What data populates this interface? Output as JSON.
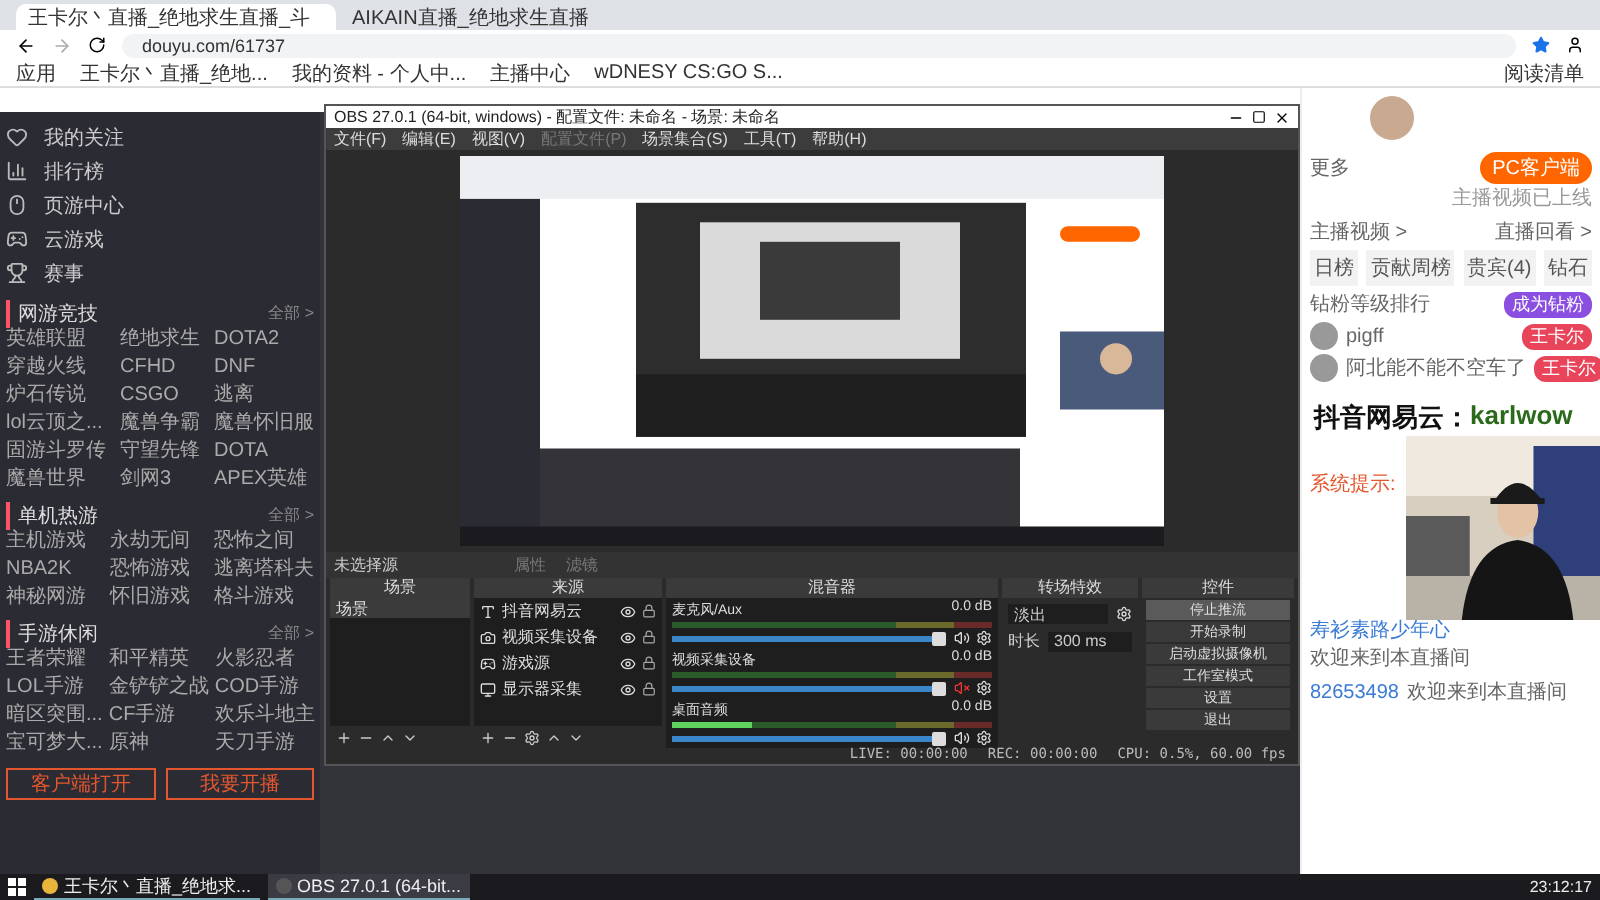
{
  "browser": {
    "tabs": [
      {
        "title": "王卡尔丶直播_绝地求生直播_斗",
        "selected": true
      },
      {
        "title": "AIKAIN直播_绝地求生直播",
        "selected": false
      }
    ],
    "url": "douyu.com/61737",
    "bookmarks": [
      "应用",
      "王卡尔丶直播_绝地...",
      "我的资料 - 个人中...",
      "主播中心",
      "wDNESY CS:GO S..."
    ],
    "reading_list": "阅读清单"
  },
  "sidebar": {
    "nav": [
      {
        "label": "我的关注",
        "kind": "heart"
      },
      {
        "label": "排行榜",
        "kind": "rank"
      },
      {
        "label": "页游中心",
        "kind": "mouse"
      },
      {
        "label": "云游戏",
        "kind": "pad"
      },
      {
        "label": "赛事",
        "kind": "trophy"
      }
    ],
    "sections": [
      {
        "title": "网游竞技",
        "more": "全部 >",
        "items": [
          "英雄联盟",
          "绝地求生",
          "DOTA2",
          "穿越火线",
          "CFHD",
          "DNF",
          "炉石传说",
          "CSGO",
          "逃离",
          "lol云顶之...",
          "魔兽争霸",
          "魔兽怀旧服",
          "固游斗罗传",
          "守望先锋",
          "DOTA",
          "魔兽世界",
          "剑网3",
          "APEX英雄"
        ]
      },
      {
        "title": "单机热游",
        "more": "全部 >",
        "items": [
          "主机游戏",
          "永劫无间",
          "恐怖之间",
          "NBA2K",
          "恐怖游戏",
          "逃离塔科夫",
          "神秘网游",
          "怀旧游戏",
          "格斗游戏"
        ]
      },
      {
        "title": "手游休闲",
        "more": "全部 >",
        "items": [
          "王者荣耀",
          "和平精英",
          "火影忍者",
          "LOL手游",
          "金铲铲之战",
          "COD手游",
          "暗区突围...",
          "CF手游",
          "欢乐斗地主",
          "宝可梦大...",
          "原神",
          "天刀手游"
        ]
      }
    ],
    "buttons": [
      "客户端打开",
      "我要开播"
    ]
  },
  "obs": {
    "title": "OBS 27.0.1 (64-bit, windows) - 配置文件: 未命名 - 场景: 未命名",
    "menu": [
      {
        "label": "文件(F)",
        "disabled": false
      },
      {
        "label": "编辑(E)",
        "disabled": false
      },
      {
        "label": "视图(V)",
        "disabled": false
      },
      {
        "label": "配置文件(P)",
        "disabled": true
      },
      {
        "label": "场景集合(S)",
        "disabled": false
      },
      {
        "label": "工具(T)",
        "disabled": false
      },
      {
        "label": "帮助(H)",
        "disabled": false
      }
    ],
    "source_bar": {
      "label": "未选择源",
      "buttons": [
        "属性",
        "滤镜"
      ]
    },
    "scenes": {
      "title": "场景",
      "items": [
        {
          "label": "场景",
          "selected": true
        }
      ]
    },
    "sources": {
      "title": "来源",
      "items": [
        {
          "label": "抖音网易云",
          "kind": "text",
          "visible": true
        },
        {
          "label": "视频采集设备",
          "kind": "camera",
          "visible": true
        },
        {
          "label": "游戏源",
          "kind": "game",
          "visible": true
        },
        {
          "label": "显示器采集",
          "kind": "monitor",
          "visible": true
        }
      ]
    },
    "mixer": {
      "title": "混音器",
      "channels": [
        {
          "name": "麦克风/Aux",
          "reading": "0.0 dB",
          "muted": false,
          "fader": {
            "level": 0.97
          }
        },
        {
          "name": "视频采集设备",
          "reading": "0.0 dB",
          "muted": true,
          "fader": {
            "level": 0.97
          }
        },
        {
          "name": "桌面音频",
          "reading": "0.0 dB",
          "muted": false,
          "meter": {
            "level": 0.25
          },
          "fader": {
            "level": 0.97
          }
        }
      ]
    },
    "transitions": {
      "title": "转场特效",
      "type": "淡出",
      "duration_label": "时长",
      "duration": "300 ms"
    },
    "controls": {
      "title": "控件",
      "buttons": [
        {
          "label": "停止推流",
          "active": true
        },
        {
          "label": "开始录制",
          "active": false
        },
        {
          "label": "启动虚拟摄像机",
          "active": false
        },
        {
          "label": "工作室模式",
          "active": false
        },
        {
          "label": "设置",
          "active": false
        },
        {
          "label": "退出",
          "active": false
        }
      ]
    },
    "status": {
      "live": "LIVE: 00:00:00",
      "rec": "REC: 00:00:00",
      "cpu": "CPU: 0.5%, 60.00 fps"
    }
  },
  "room": {
    "more": "更多",
    "pc_button": "PC客户端",
    "notice": "主播视频已上线",
    "links": [
      "主播视频 >",
      "直播回看 >"
    ],
    "rank_tabs": [
      "日榜",
      "贡献周榜",
      "贵宾(4)",
      "钻石"
    ],
    "rank_title": "钻粉等级排行",
    "rank_button": "成为钻粉",
    "fans": [
      {
        "name": "pigff",
        "badge": "王卡尔"
      },
      {
        "name": "阿北能不能不空车了",
        "badge": "王卡尔"
      }
    ],
    "system": "系统提示:",
    "chat": [
      {
        "user": "寿衫素路少年心",
        "text": "欢迎来到本直播间"
      },
      {
        "user": "82653498",
        "text": "欢迎来到本直播间"
      }
    ],
    "overlay": {
      "prefix": "抖音网易云：",
      "handle": "karlwow"
    }
  },
  "taskbar": {
    "items": [
      {
        "label": "王卡尔丶直播_绝地求...",
        "kind": "chrome",
        "selected": false
      },
      {
        "label": "OBS 27.0.1 (64-bit...",
        "kind": "obs",
        "selected": true
      }
    ],
    "clock": "23:12:17"
  }
}
